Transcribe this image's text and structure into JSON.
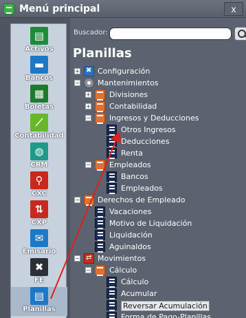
{
  "window": {
    "title": "Menú principal",
    "close_label": "x"
  },
  "sidebar": {
    "items": [
      {
        "label": "Activos",
        "icon": "cash-register-icon",
        "color": "#1f8a3a"
      },
      {
        "label": "Bancos",
        "icon": "briefcase-icon",
        "color": "#1e78c8"
      },
      {
        "label": "Boletas",
        "icon": "document-chart-icon",
        "color": "#1d7a2f"
      },
      {
        "label": "Contabilidad",
        "icon": "line-chart-icon",
        "color": "#66b82a"
      },
      {
        "label": "CRM",
        "icon": "globe-icon",
        "color": "#1f9a8a"
      },
      {
        "label": "CXC",
        "icon": "person-cart-icon",
        "color": "#c8281e"
      },
      {
        "label": "CXP",
        "icon": "exchange-icon",
        "color": "#c8281e"
      },
      {
        "label": "Emisario",
        "icon": "envelope-icon",
        "color": "#1e78c8"
      },
      {
        "label": "FE",
        "icon": "tools-icon",
        "color": "#2c2f36"
      },
      {
        "label": "Planillas",
        "icon": "payroll-icon",
        "color": "#1e78c8"
      }
    ]
  },
  "search": {
    "label": "Buscador:",
    "value": ""
  },
  "main": {
    "heading": "Planillas"
  },
  "tree": [
    {
      "label": "Configuración",
      "level": 0,
      "expander": "+",
      "icon": "config-icon"
    },
    {
      "label": "Mantenimientos",
      "level": 0,
      "expander": "−",
      "icon": "gear-icon"
    },
    {
      "label": "Divisiones",
      "level": 1,
      "expander": "+",
      "icon": "folder-icon"
    },
    {
      "label": "Contabilidad",
      "level": 1,
      "expander": "+",
      "icon": "folder-icon"
    },
    {
      "label": "Ingresos y Deducciones",
      "level": 1,
      "expander": "−",
      "icon": "folder-icon"
    },
    {
      "label": "Otros Ingresos",
      "level": 2,
      "expander": "",
      "icon": "form-icon"
    },
    {
      "label": "Deducciones",
      "level": 2,
      "expander": "",
      "icon": "form-icon"
    },
    {
      "label": "Renta",
      "level": 2,
      "expander": "",
      "icon": "form-icon"
    },
    {
      "label": "Empleados",
      "level": 1,
      "expander": "−",
      "icon": "folder-icon"
    },
    {
      "label": "Bancos",
      "level": 2,
      "expander": "",
      "icon": "form-icon"
    },
    {
      "label": "Empleados",
      "level": 2,
      "expander": "",
      "icon": "form-icon"
    },
    {
      "label": "Derechos de Empleado",
      "level": 0,
      "expander": "−",
      "icon": "folder-icon"
    },
    {
      "label": "Vacaciones",
      "level": 1,
      "expander": "",
      "icon": "form-icon"
    },
    {
      "label": "Motivo de Liquidación",
      "level": 1,
      "expander": "",
      "icon": "form-icon"
    },
    {
      "label": "Liquidación",
      "level": 1,
      "expander": "",
      "icon": "form-icon"
    },
    {
      "label": "Aguinaldos",
      "level": 1,
      "expander": "",
      "icon": "form-icon"
    },
    {
      "label": "Movimientos",
      "level": 0,
      "expander": "−",
      "icon": "shuffle-icon"
    },
    {
      "label": "Cálculo",
      "level": 1,
      "expander": "−",
      "icon": "folder-icon"
    },
    {
      "label": "Cálculo",
      "level": 2,
      "expander": "",
      "icon": "form-icon"
    },
    {
      "label": "Acumular",
      "level": 2,
      "expander": "",
      "icon": "form-icon"
    },
    {
      "label": "Reversar Acumulación",
      "level": 2,
      "expander": "",
      "icon": "form-icon",
      "selected": true
    },
    {
      "label": "Forma de Pago-Planillas Acumulad",
      "level": 2,
      "expander": "",
      "icon": "form-icon"
    }
  ]
}
